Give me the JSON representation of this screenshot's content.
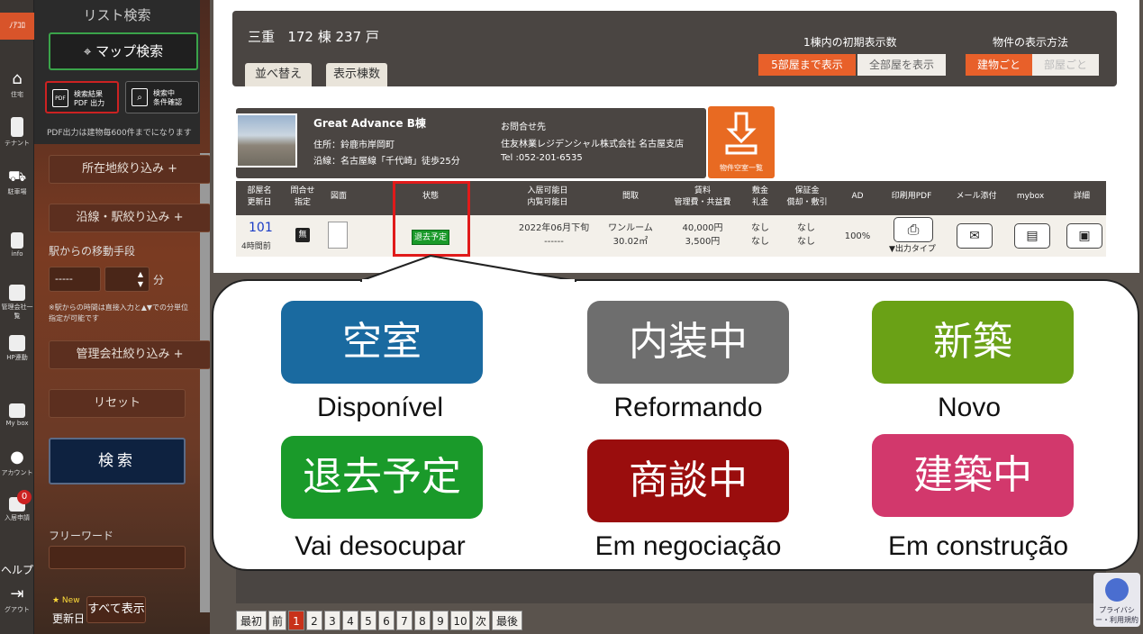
{
  "rail": {
    "logo": "ﾉｱｺﾛ",
    "items": [
      {
        "icon": "house-icon",
        "label": "住宅"
      },
      {
        "icon": "building-icon",
        "label": "テナント"
      },
      {
        "icon": "car-icon",
        "label": "駐車場"
      },
      {
        "icon": "info-icon",
        "label": "info"
      },
      {
        "icon": "company-icon",
        "label": "管理会社一覧"
      },
      {
        "icon": "hp-icon",
        "label": "HP連動"
      },
      {
        "icon": "mybox-icon",
        "label": "My box"
      },
      {
        "icon": "account-icon",
        "label": "アカウント"
      },
      {
        "icon": "application-icon",
        "label": "入居申請"
      },
      {
        "icon": "help-icon",
        "label": "ヘルプ"
      },
      {
        "icon": "logout-icon",
        "label": "グアウト"
      }
    ],
    "badge": "0"
  },
  "panel": {
    "title": "リスト検索",
    "map_search": "マップ検索",
    "pdf_btn": {
      "line1": "検索結果",
      "line2": "PDF 出力"
    },
    "cond_btn": {
      "line1": "検索中",
      "line2": "条件確認"
    },
    "pdf_note": "PDF出力は建物毎600件までになります",
    "location_filter": "所在地絞り込み +",
    "line_filter": "沿線・駅絞り込み +",
    "move_label": "駅からの移動手段",
    "move_value": "-----",
    "minute_unit": "分",
    "minute_note": "※駅からの時間は直接入力と▲▼での分単位指定が可能です",
    "company_filter": "管理会社絞り込み +",
    "reset": "リセット",
    "search": "検索",
    "freeword": "フリーワード",
    "new_label": "★ New",
    "updated_label": "更新日",
    "show_all": "すべて表示"
  },
  "header": {
    "area": "三重",
    "count": "172 棟 237 戸",
    "tabs": [
      "並べ替え",
      "表示棟数"
    ],
    "initial_display_label": "1棟内の初期表示数",
    "initial_options": [
      "5部屋まで表示",
      "全部屋を表示"
    ],
    "display_method_label": "物件の表示方法",
    "display_options": [
      "建物ごと",
      "部屋ごと"
    ]
  },
  "building": {
    "name": "Great Advance B棟",
    "address": "住所：鈴鹿市岸岡町",
    "line": "沿線：名古屋線「千代崎」徒歩25分",
    "contact_label": "お問合せ先",
    "contact_company": "住友林業レジデンシャル株式会社 名古屋支店",
    "contact_tel": "Tel :052-201-6535",
    "vacant_list": "物件空室一覧"
  },
  "table": {
    "headers": {
      "room": [
        "部屋名",
        "更新日"
      ],
      "inquiry": [
        "問合せ",
        "指定"
      ],
      "plan": "図面",
      "status": "状態",
      "movein": [
        "入居可能日",
        "内覧可能日"
      ],
      "layout": "間取",
      "rent": [
        "賃料",
        "管理費・共益費"
      ],
      "deposit": [
        "敷金",
        "礼金"
      ],
      "guarantee": [
        "保証金",
        "償却・敷引"
      ],
      "ad": "AD",
      "pdf": "印刷用PDF",
      "mail": "メール添付",
      "mybox": "mybox",
      "detail": "詳細"
    },
    "row": {
      "room": "101",
      "updated": "4時間前",
      "inquiry": "無",
      "status": "退去予定",
      "movein": "2022年06月下旬",
      "preview": "------",
      "layout": "ワンルーム",
      "area": "30.02㎡",
      "rent": "40,000円",
      "fee": "3,500円",
      "deposit": "なし",
      "key_money": "なし",
      "guarantee": "なし",
      "amort": "なし",
      "ad": "100%",
      "output_type": "▼出力タイプ"
    }
  },
  "legend": [
    {
      "label": "空室",
      "caption": "Disponível",
      "color": "#1a6aa0"
    },
    {
      "label": "内装中",
      "caption": "Reformando",
      "color": "#6e6e6e"
    },
    {
      "label": "新築",
      "caption": "Novo",
      "color": "#6aa116"
    },
    {
      "label": "退去予定",
      "caption": "Vai desocupar",
      "color": "#1a9a2a"
    },
    {
      "label": "商談中",
      "caption": "Em negociação",
      "color": "#9a0d0d"
    },
    {
      "label": "建築中",
      "caption": "Em construção",
      "color": "#d2386c"
    }
  ],
  "pagination": {
    "first": "最初",
    "prev": "前",
    "pages": [
      "1",
      "2",
      "3",
      "4",
      "5",
      "6",
      "7",
      "8",
      "9",
      "10"
    ],
    "next": "次",
    "last": "最後"
  },
  "privacy": "プライバシー・利用規約"
}
